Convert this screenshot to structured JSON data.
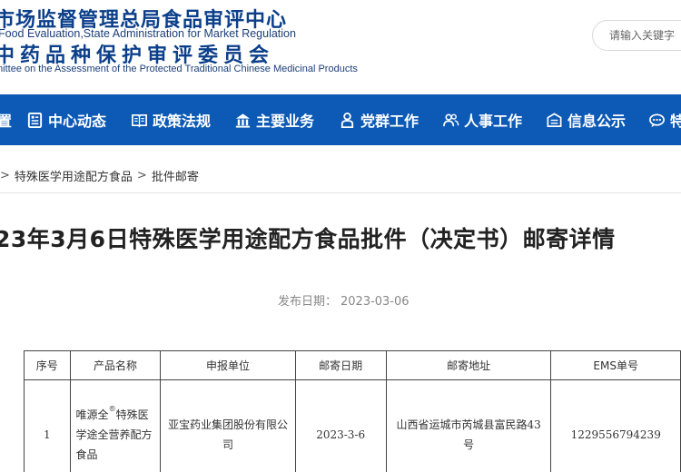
{
  "header": {
    "line1": "市场监督管理总局食品审评中心",
    "line2": "Food Evaluation,State Administration for Market Regulation",
    "line3": "中药品种保护审评委员会",
    "line4": "mittee on the Assessment of the Protected Traditional Chinese Medicinal Products"
  },
  "search": {
    "placeholder": "请输入关键字"
  },
  "nav": {
    "items": [
      {
        "label": "置",
        "icon": "home-icon"
      },
      {
        "label": "中心动态",
        "icon": "news-icon"
      },
      {
        "label": "政策法规",
        "icon": "book-icon"
      },
      {
        "label": "主要业务",
        "icon": "building-icon"
      },
      {
        "label": "党群工作",
        "icon": "person-icon"
      },
      {
        "label": "人事工作",
        "icon": "people-icon"
      },
      {
        "label": "信息公示",
        "icon": "notice-icon"
      },
      {
        "label": "特",
        "icon": "chat-icon"
      }
    ],
    "bg_color": "#0d5ab6"
  },
  "breadcrumb": {
    "items": [
      "特殊医学用途配方食品",
      "批件邮寄"
    ],
    "separator": ">"
  },
  "article": {
    "title": "23年3月6日特殊医学用途配方食品批件（决定书）邮寄详情",
    "date_label": "发布日期：",
    "date": "2023-03-06"
  },
  "table": {
    "headers": [
      "序号",
      "产品名称",
      "申报单位",
      "邮寄日期",
      "邮寄地址",
      "EMS单号"
    ],
    "rows": [
      {
        "index": "1",
        "product_part1": "唯源全",
        "product_mark": "®",
        "product_part2": "特殊医学途全营养配方食品",
        "applicant": "亚宝药业集团股份有限公司",
        "mail_date": "2023-3-6",
        "address": "山西省运城市芮城县富民路43号",
        "ems": "1229556794239"
      }
    ]
  }
}
